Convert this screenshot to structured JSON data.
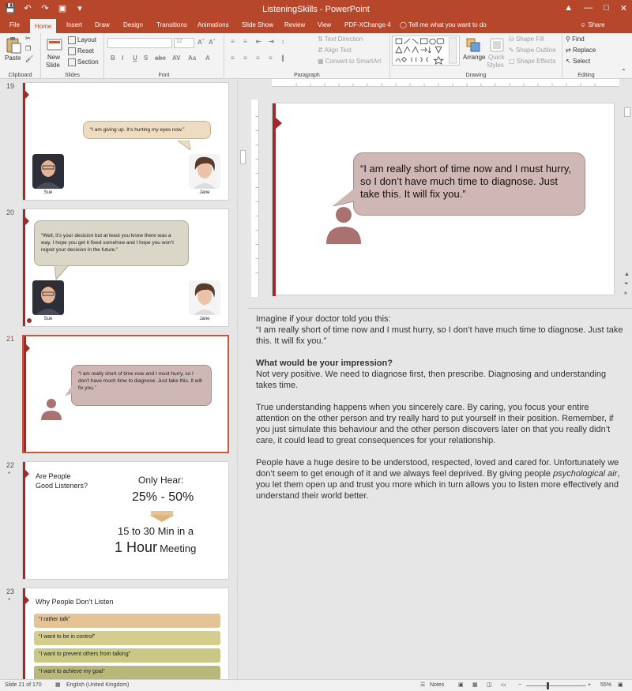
{
  "window": {
    "title": "ListeningSkills  -  PowerPoint",
    "min": "—",
    "restore": "□",
    "close": "✕"
  },
  "tabs": [
    {
      "label": "File"
    },
    {
      "label": "Home"
    },
    {
      "label": "Insert"
    },
    {
      "label": "Draw"
    },
    {
      "label": "Design"
    },
    {
      "label": "Transitions"
    },
    {
      "label": "Animations"
    },
    {
      "label": "Slide Show"
    },
    {
      "label": "Review"
    },
    {
      "label": "View"
    },
    {
      "label": "PDF-XChange 4"
    }
  ],
  "tellme": "Tell me what you want to do",
  "share": "Share",
  "ribbon": {
    "clipboard": {
      "label": "Clipboard",
      "paste": "Paste"
    },
    "slides": {
      "label": "Slides",
      "new_slide": "New",
      "new_slide2": "Slide",
      "layout": "Layout",
      "reset": "Reset",
      "section": "Section"
    },
    "font": {
      "label": "Font",
      "size": "12"
    },
    "paragraph": {
      "label": "Paragraph",
      "text_direction": "Text Direction",
      "align_text": "Align Text",
      "convert": "Convert to SmartArt"
    },
    "drawing": {
      "label": "Drawing",
      "arrange": "Arrange",
      "quick": "Quick",
      "styles": "Styles",
      "fill": "Shape Fill",
      "outline": "Shape Outline",
      "effects": "Shape Effects"
    },
    "editing": {
      "label": "Editing",
      "find": "Find",
      "replace": "Replace",
      "select": "Select"
    }
  },
  "thumbs": {
    "s19": {
      "num": "19",
      "bubble": "“I am giving up. It’s hurting my eyes now.”",
      "left": "Sue",
      "right": "Jane"
    },
    "s20": {
      "num": "20",
      "bubble": "“Well, it’s your decision but at least you know there was a way. I hope you get it fixed somehow and I hope you won’t regret your decision in the future.”",
      "left": "Sue",
      "right": "Jane"
    },
    "s21": {
      "num": "21",
      "bubble": "“I am really short of time now and I must hurry, so I don’t have much time to diagnose. Just take this. It will fix you.”"
    },
    "s22": {
      "num": "22",
      "star": "*",
      "question_line1": "Are People",
      "question_line2": "Good Listeners?",
      "only_hear": "Only Hear:",
      "percent": "25% - 50%",
      "minutes": "15 to 30 Min in a",
      "hour_big": "1 Hour",
      "meeting": "Meeting"
    },
    "s23": {
      "num": "23",
      "star": "*",
      "title": "Why People Don’t Listen",
      "items": [
        "“I rather talk”",
        "“I want to be in control”",
        "“I want to prevent others from talking”",
        "“I want to achieve my goal”"
      ]
    }
  },
  "slide": {
    "bubble": "“I am really short of time now and I must hurry, so I don’t have much time to diagnose. Just take this. It will fix you.”"
  },
  "notes": {
    "p1a": "Imagine if your doctor told you this:",
    "p1b": "“I am really short of time now and I must hurry, so I don’t have much time to diagnose. Just take this. It will fix you.”",
    "heading": "What would be your impression?",
    "p2": "Not very positive. We need to diagnose first, then prescribe. Diagnosing and understanding takes time.",
    "p3": "True understanding happens when you sincerely care. By caring, you focus your entire attention on the other person and try really hard to put yourself in their position. Remember, if you just simulate this behaviour and the other person discovers later on that you really didn’t care, it could lead to great consequences for your relationship.",
    "p4a": "People have a huge desire to be understood, respected, loved and cared for. Unfortunately we don’t seem to get enough of it and we always feel deprived. By giving people ",
    "p4i": "psychological air",
    "p4b": ", you let them open up and trust you more which in turn allows you to listen more effectively and understand their world better."
  },
  "status": {
    "slide": "Slide 21 of 170",
    "language": "English (United Kingdom)",
    "notes": "Notes",
    "zoom": "55%",
    "minus": "−",
    "plus": "+"
  },
  "colors": {
    "accent": "#b7472a",
    "bubble_tan": "#eedcc0",
    "bubble_grey": "#dad6c8",
    "bubble_rose": "#cfb7b5",
    "person": "#a9726f",
    "bar1": "#e4c496",
    "bar2": "#d4cd8e",
    "bar3": "#c9c886",
    "bar4": "#b8b878"
  }
}
